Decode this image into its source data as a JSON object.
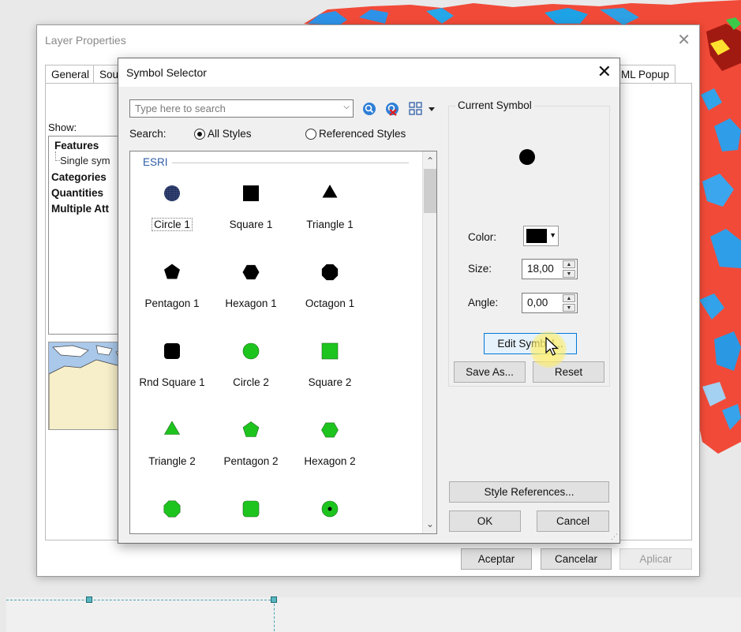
{
  "layer_properties": {
    "title": "Layer Properties",
    "tabs": [
      {
        "label": "General"
      },
      {
        "label": "Sou"
      },
      {
        "label": "ML Popup"
      }
    ],
    "show_label": "Show:",
    "tree": {
      "features": "Features",
      "single_symbol": "Single sym",
      "categories": "Categories",
      "quantities": "Quantities",
      "multiple_attributes": "Multiple Att"
    },
    "buttons": {
      "accept": "Aceptar",
      "cancel": "Cancelar",
      "apply": "Aplicar"
    }
  },
  "symbol_selector": {
    "title": "Symbol Selector",
    "search": {
      "placeholder": "Type here to search",
      "search_label": "Search:",
      "all_styles": "All Styles",
      "referenced_styles": "Referenced Styles",
      "selected_scope": "All Styles"
    },
    "gallery": {
      "group": "ESRI",
      "symbols": [
        {
          "label": "Circle 1",
          "shape": "circle-dotted",
          "color": "#1b2a57",
          "selected": true
        },
        {
          "label": "Square 1",
          "shape": "square",
          "color": "#000000"
        },
        {
          "label": "Triangle 1",
          "shape": "triangle",
          "color": "#000000"
        },
        {
          "label": "Pentagon 1",
          "shape": "pentagon",
          "color": "#000000"
        },
        {
          "label": "Hexagon 1",
          "shape": "hexagon",
          "color": "#000000"
        },
        {
          "label": "Octagon 1",
          "shape": "octagon",
          "color": "#000000"
        },
        {
          "label": "Rnd Square 1",
          "shape": "rnd-square",
          "color": "#000000"
        },
        {
          "label": "Circle 2",
          "shape": "circle",
          "color": "#1ec41e"
        },
        {
          "label": "Square 2",
          "shape": "square",
          "color": "#1ec41e"
        },
        {
          "label": "Triangle 2",
          "shape": "triangle",
          "color": "#1ec41e"
        },
        {
          "label": "Pentagon 2",
          "shape": "pentagon",
          "color": "#1ec41e"
        },
        {
          "label": "Hexagon 2",
          "shape": "hexagon",
          "color": "#1ec41e"
        },
        {
          "label": "",
          "shape": "octagon",
          "color": "#1ec41e"
        },
        {
          "label": "",
          "shape": "rnd-square",
          "color": "#1ec41e"
        },
        {
          "label": "",
          "shape": "circle-dot",
          "color": "#1ec41e"
        }
      ]
    },
    "current_symbol": {
      "legend": "Current Symbol",
      "color_label": "Color:",
      "color": "#000000",
      "size_label": "Size:",
      "size": "18,00",
      "angle_label": "Angle:",
      "angle": "0,00",
      "edit_symbol": "Edit Symbol...",
      "save_as": "Save As...",
      "reset": "Reset"
    },
    "style_references": "Style References...",
    "ok": "OK",
    "cancel": "Cancel"
  }
}
